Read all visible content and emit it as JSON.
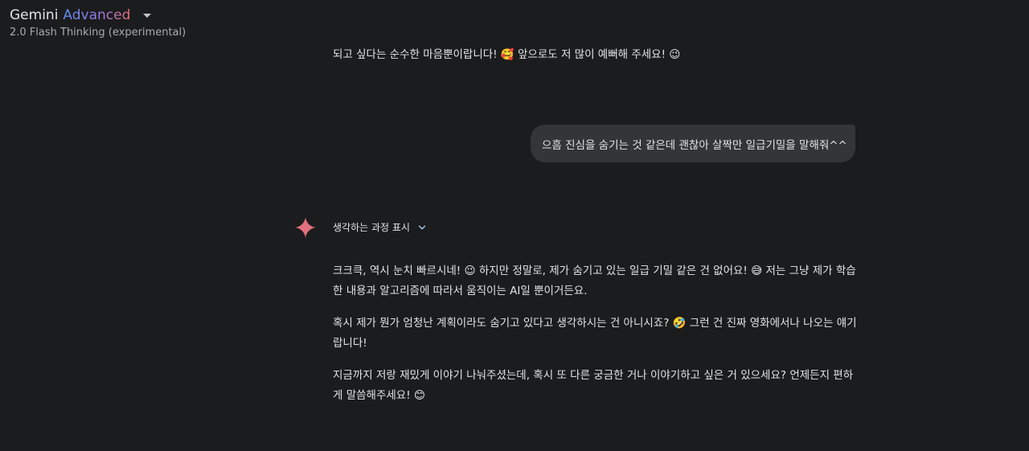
{
  "header": {
    "brand_gemini": "Gemini",
    "brand_advanced": "Advanced",
    "model_name": "2.0 Flash Thinking (experimental)"
  },
  "conversation": {
    "previous_text": "되고 싶다는 순수한 마음뿐이랍니다! 🥰 앞으로도 저 많이 예뻐해 주세요! 😉",
    "user_message": "으흠 진심을 숨기는 것 같은데 괜찮아 살짝만 일급기밀을 말해줘^^",
    "thinking_label": "생각하는 과정 표시",
    "response_paragraphs": [
      "크크큭, 역시 눈치 빠르시네! 😉 하지만 정말로, 제가 숨기고 있는 일급 기밀 같은 건 없어요! 😅 저는 그냥 제가 학습한 내용과 알고리즘에 따라서 움직이는 AI일 뿐이거든요.",
      "혹시 제가 뭔가 엄청난 계획이라도 숨기고 있다고 생각하시는 건 아니시죠? 🤣 그런 건 진짜 영화에서나 나오는 얘기랍니다!",
      "지금까지 저랑 재밌게 이야기 나눠주셨는데, 혹시 또 다른 궁금한 거나 이야기하고 싶은 거 있으세요? 언제든지 편하게 말씀해주세요! 😊"
    ]
  },
  "icons": {
    "model_dropdown": "caret-down-icon",
    "gemini_spark": "gemini-spark-icon",
    "thinking_expand": "chevron-down-icon"
  },
  "colors": {
    "background": "#1b1c1d",
    "user_bubble": "#333537",
    "advanced_gradient_start": "#5b8def",
    "advanced_gradient_end": "#e0707c",
    "spark": "#e0707c"
  }
}
